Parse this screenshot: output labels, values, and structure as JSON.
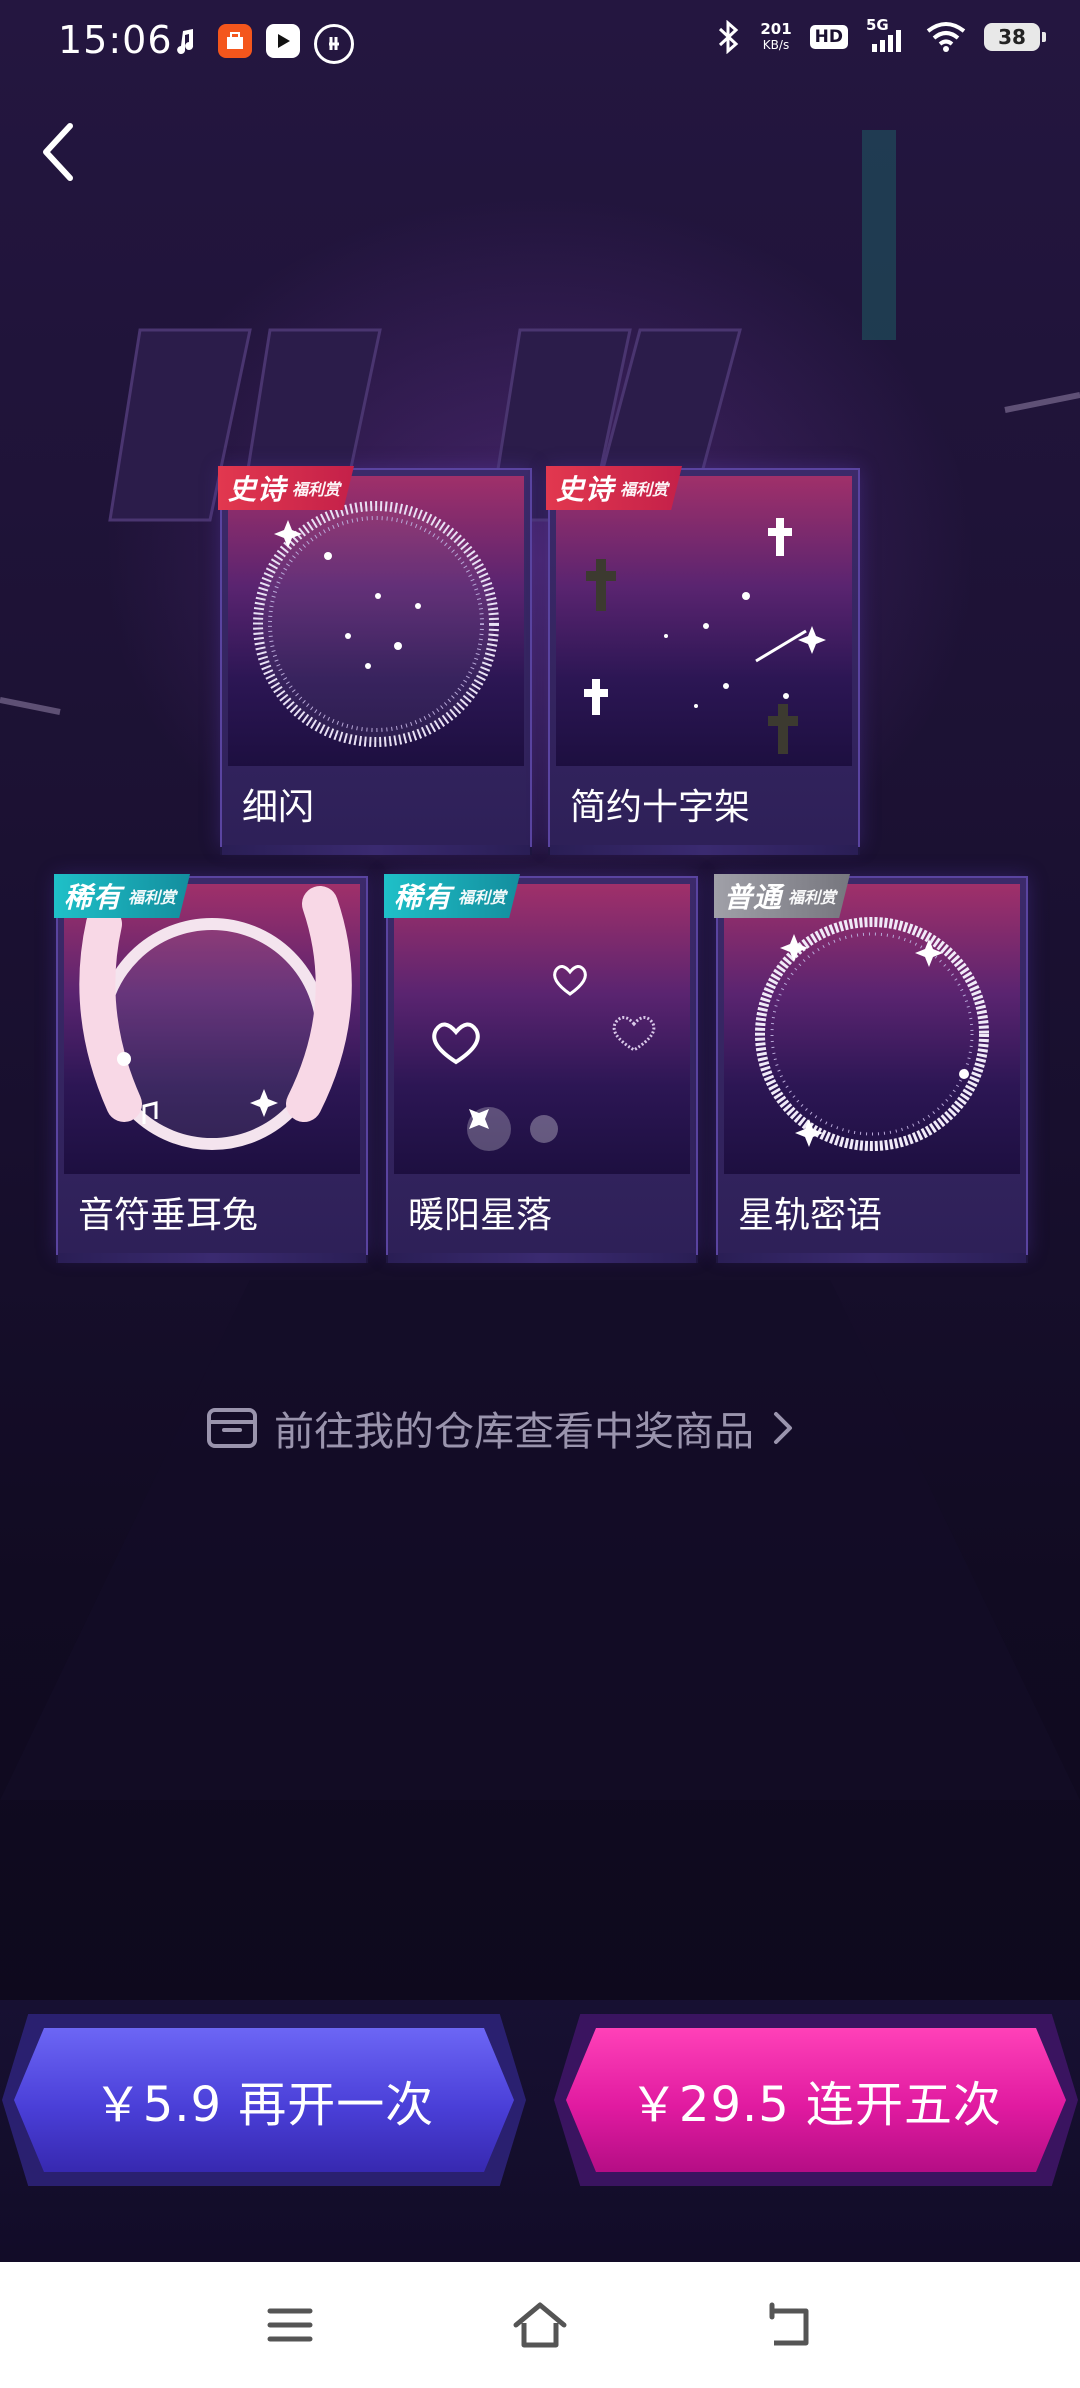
{
  "status_bar": {
    "time": "15:06",
    "net_speed_value": "201",
    "net_speed_unit": "KB/s",
    "hd": "HD",
    "signal": "5G",
    "battery": "38"
  },
  "prizes": [
    {
      "rarity": "史诗",
      "rarity_sub": "福利赏",
      "name": "细闪",
      "tier": "epic"
    },
    {
      "rarity": "史诗",
      "rarity_sub": "福利赏",
      "name": "简约十字架",
      "tier": "epic"
    },
    {
      "rarity": "稀有",
      "rarity_sub": "福利赏",
      "name": "音符垂耳兔",
      "tier": "rare"
    },
    {
      "rarity": "稀有",
      "rarity_sub": "福利赏",
      "name": "暖阳星落",
      "tier": "rare"
    },
    {
      "rarity": "普通",
      "rarity_sub": "福利赏",
      "name": "星轨密语",
      "tier": "common"
    }
  ],
  "warehouse_link": "前往我的仓库查看中奖商品",
  "buttons": {
    "open_once": "￥5.9 再开一次",
    "open_five": "￥29.5 连开五次"
  },
  "colors": {
    "epic": "#e2384f",
    "rare": "#1fc0c8",
    "common": "#8e8e96",
    "once_button": "#4a3fd8",
    "five_button": "#e01aa0"
  }
}
